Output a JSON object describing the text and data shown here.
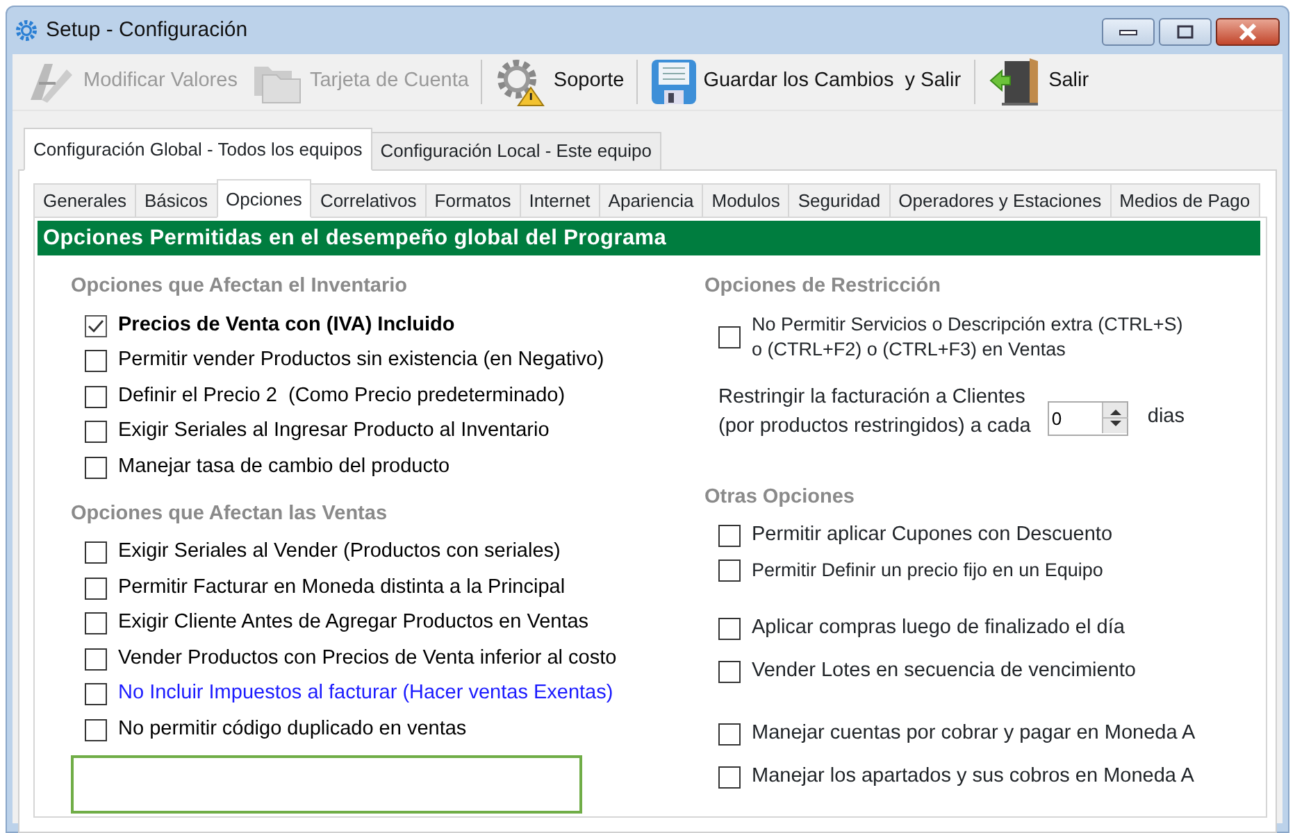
{
  "window": {
    "title": "Setup - Configuración"
  },
  "toolbar": [
    {
      "kind": "edit",
      "label": "Modificar Valores",
      "disabled": true
    },
    {
      "kind": "card",
      "label": "Tarjeta de Cuenta",
      "disabled": true
    },
    {
      "kind": "support",
      "label": "Soporte",
      "disabled": false
    },
    {
      "kind": "save",
      "label": "Guardar los Cambios  y Salir",
      "disabled": false
    },
    {
      "kind": "exit",
      "label": "Salir",
      "disabled": false
    }
  ],
  "outer_tabs": [
    {
      "label": "Configuración Global - Todos los equipos",
      "selected": true
    },
    {
      "label": "Configuración Local - Este equipo",
      "selected": false
    }
  ],
  "inner_tabs": [
    {
      "label": "Generales",
      "selected": false
    },
    {
      "label": "Básicos",
      "selected": false
    },
    {
      "label": "Opciones",
      "selected": true
    },
    {
      "label": "Correlativos",
      "selected": false
    },
    {
      "label": "Formatos",
      "selected": false
    },
    {
      "label": "Internet",
      "selected": false
    },
    {
      "label": "Apariencia",
      "selected": false
    },
    {
      "label": "Modulos",
      "selected": false
    },
    {
      "label": "Seguridad",
      "selected": false
    },
    {
      "label": "Operadores y Estaciones",
      "selected": false
    },
    {
      "label": "Medios de Pago",
      "selected": false
    }
  ],
  "header": "Opciones Permitidas en el desempeño global del Programa",
  "inventory": {
    "title": "Opciones que Afectan el Inventario",
    "options": [
      {
        "label": "Precios de Venta con (IVA) Incluido",
        "checked": true,
        "bold": true,
        "color": "#000000"
      },
      {
        "label": "Permitir vender Productos sin existencia (en Negativo)",
        "checked": false,
        "bold": false,
        "color": "#000000"
      },
      {
        "label": "Definir el Precio 2  (Como Precio predeterminado)",
        "checked": false,
        "bold": false,
        "color": "#000000"
      },
      {
        "label": "Exigir Seriales al Ingresar Producto al Inventario",
        "checked": false,
        "bold": false,
        "color": "#000000"
      },
      {
        "label": "Manejar tasa de cambio del producto",
        "checked": false,
        "bold": false,
        "color": "#000000"
      }
    ]
  },
  "sales": {
    "title": "Opciones que Afectan las Ventas",
    "options": [
      {
        "label": "Exigir Seriales al Vender (Productos con seriales)",
        "checked": false,
        "bold": false,
        "color": "#000000"
      },
      {
        "label": "Permitir Facturar en Moneda distinta a la Principal",
        "checked": false,
        "bold": false,
        "color": "#000000"
      },
      {
        "label": "Exigir Cliente Antes de Agregar Productos en Ventas",
        "checked": false,
        "bold": false,
        "color": "#000000"
      },
      {
        "label": "Vender Productos con Precios de Venta inferior al costo",
        "checked": false,
        "bold": false,
        "color": "#000000"
      },
      {
        "label": "No Incluir Impuestos al facturar (Hacer ventas Exentas)",
        "checked": false,
        "bold": false,
        "color": "#1a1aff"
      },
      {
        "label": "No permitir código duplicado en ventas",
        "checked": false,
        "bold": false,
        "color": "#000000"
      }
    ]
  },
  "restriction": {
    "title": "Opciones de Restricción",
    "option": {
      "label_lines": [
        "No Permitir Servicios o Descripción extra (CTRL+S)",
        "o (CTRL+F2) o (CTRL+F3) en Ventas"
      ],
      "checked": false
    },
    "limit": {
      "label_lines": [
        "Restringir la facturación a Clientes",
        "(por productos restringidos) a cada"
      ],
      "value": "0",
      "unit": "dias"
    }
  },
  "other": {
    "title": "Otras Opciones",
    "groups": [
      [
        {
          "label": "Permitir aplicar Cupones con Descuento",
          "checked": false
        },
        {
          "label": "Permitir Definir un precio fijo en un Equipo",
          "checked": false
        }
      ],
      [
        {
          "label": "Aplicar compras luego de finalizado el día",
          "checked": false
        },
        {
          "label": "Vender Lotes en secuencia de vencimiento",
          "checked": false
        }
      ],
      [
        {
          "label": "Manejar cuentas por cobrar y pagar en Moneda A",
          "checked": false
        },
        {
          "label": "Manejar los apartados y sus cobros en Moneda A",
          "checked": false
        }
      ]
    ]
  }
}
